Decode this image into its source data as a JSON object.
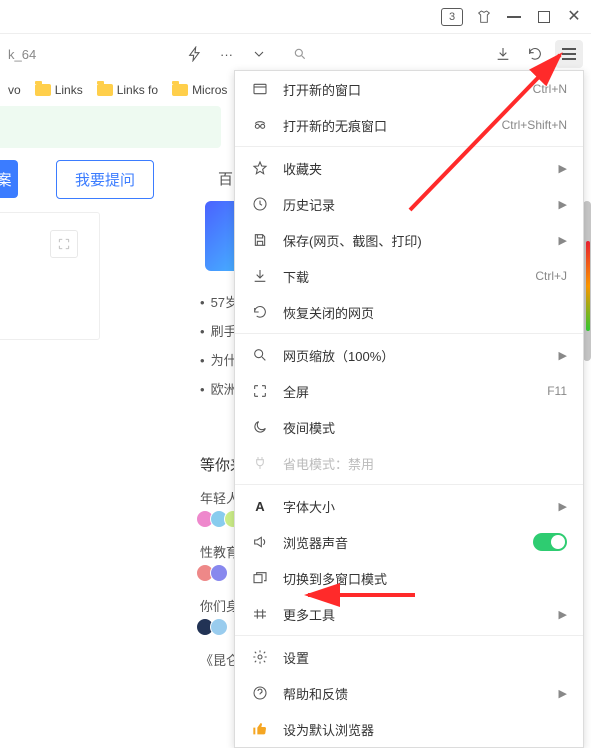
{
  "titlebar": {
    "badge": "3"
  },
  "toolbar": {
    "tab_text": "k_64"
  },
  "bookmarks": {
    "items": [
      "vo",
      "Links",
      "Links fo",
      "Micros"
    ]
  },
  "page": {
    "btn_solid": "案",
    "btn_outline": "我要提问",
    "baidu_partial": "百",
    "bullets": [
      "57岁",
      "刷手",
      "为什",
      "欧洲"
    ],
    "section_wait": "等你来",
    "row1": "年轻人",
    "row2": "性教育",
    "row3": "你们身",
    "row4": "《昆仑"
  },
  "menu": {
    "new_window": {
      "label": "打开新的窗口",
      "hint": "Ctrl+N"
    },
    "incognito": {
      "label": "打开新的无痕窗口",
      "hint": "Ctrl+Shift+N"
    },
    "favorites": {
      "label": "收藏夹"
    },
    "history": {
      "label": "历史记录"
    },
    "save": {
      "label": "保存(网页、截图、打印)"
    },
    "download": {
      "label": "下载",
      "hint": "Ctrl+J"
    },
    "restore": {
      "label": "恢复关闭的网页"
    },
    "zoom": {
      "label": "网页缩放（100%）"
    },
    "fullscreen": {
      "label": "全屏",
      "hint": "F11"
    },
    "night": {
      "label": "夜间模式"
    },
    "powersave": {
      "label": "省电模式：禁用"
    },
    "fontsize": {
      "label": "字体大小"
    },
    "sound": {
      "label": "浏览器声音"
    },
    "multiwindow": {
      "label": "切换到多窗口模式"
    },
    "moretools": {
      "label": "更多工具"
    },
    "settings": {
      "label": "设置"
    },
    "help": {
      "label": "帮助和反馈"
    },
    "default": {
      "label": "设为默认浏览器"
    }
  }
}
